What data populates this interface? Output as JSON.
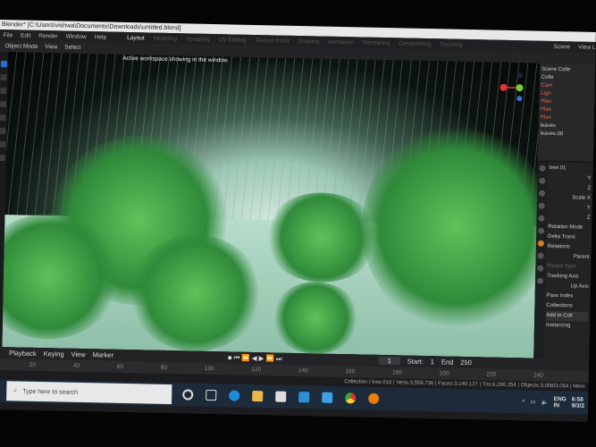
{
  "window": {
    "title": "Blender* [C:\\Users\\vishwa\\Documents\\Downloads\\untitled.blend]"
  },
  "menu": [
    "File",
    "Edit",
    "Render",
    "Window",
    "Help"
  ],
  "workspaces": [
    "Layout",
    "Modeling",
    "Sculpting",
    "UV Editing",
    "Texture Paint",
    "Shading",
    "Animation",
    "Rendering",
    "Compositing",
    "Scripting"
  ],
  "active_workspace": "Layout",
  "tooltip": "Active workspace showing in the window.",
  "header": {
    "mode": "Object Mode",
    "view": "View",
    "select": "Select",
    "scene": "Scene",
    "view_layer": "View L"
  },
  "outliner": {
    "items": [
      "Scene Colle",
      "Colle",
      "Cam",
      "Ligh",
      "Plan",
      "Plan",
      "Plan",
      "leaves",
      "leaves.00"
    ]
  },
  "properties": {
    "object": "tree.01",
    "rows": [
      "Y",
      "Z",
      "Scale X",
      "Y",
      "Z",
      "Rotation Mode",
      "Delta Trans",
      "Relations",
      "Parent",
      "Parent Type",
      "Tracking Axis",
      "Up Axis",
      "Pass Index",
      "Collections",
      "Add to Coll",
      "Instancing"
    ]
  },
  "timeline": {
    "playback": "Playback",
    "keying": "Keying",
    "view": "View",
    "marker": "Marker",
    "current_frame": "1",
    "start_label": "Start:",
    "start": "1",
    "end_label": "End",
    "end": "250",
    "ticks": [
      "20",
      "40",
      "60",
      "80",
      "100",
      "120",
      "140",
      "160",
      "180",
      "200",
      "220",
      "240"
    ]
  },
  "status": "Collection | tree.010 | Verts:3,559,736 | Faces:3,140,127 | Tris:6,280,254 | Objects:3,008/3,064 | Mem",
  "taskbar": {
    "search_placeholder": "Type here to search",
    "lang": "ENG",
    "region": "IN",
    "time": "6:58",
    "date": "9/3/2"
  }
}
